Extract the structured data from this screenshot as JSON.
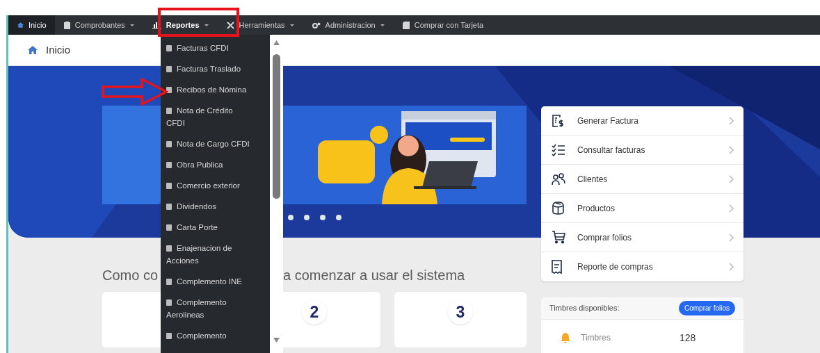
{
  "nav": {
    "items": [
      {
        "label": "Inicio",
        "selected": true,
        "dropdown": false,
        "expanded": false
      },
      {
        "label": "Comprobantes",
        "selected": false,
        "dropdown": true,
        "expanded": false
      },
      {
        "label": "Reportes",
        "selected": false,
        "dropdown": true,
        "expanded": true
      },
      {
        "label": "Herramientas",
        "selected": false,
        "dropdown": true,
        "expanded": false
      },
      {
        "label": "Administracion",
        "selected": false,
        "dropdown": true,
        "expanded": false
      },
      {
        "label": "Comprar con Tarjeta",
        "selected": false,
        "dropdown": false,
        "expanded": false
      }
    ]
  },
  "breadcrumb": {
    "label": "Inicio"
  },
  "reportes_menu": {
    "items": [
      {
        "label": "Facturas CFDI"
      },
      {
        "label": "Facturas Traslado"
      },
      {
        "label": "Recibos de Nómina"
      },
      {
        "label": "Nota de Crédito CFDI"
      },
      {
        "label": "Nota de Cargo CFDI"
      },
      {
        "label": "Obra Publica"
      },
      {
        "label": "Comercio exterior"
      },
      {
        "label": "Dividendos"
      },
      {
        "label": "Carta Porte"
      },
      {
        "label": "Enajenacion de Acciones"
      },
      {
        "label": "Complemento INE"
      },
      {
        "label": "Complemento Aerolineas"
      },
      {
        "label": "Complemento"
      }
    ]
  },
  "heading": {
    "left_part": "Como co",
    "right_part": "a comenzar a usar el sistema"
  },
  "step_cards": [
    {
      "kind": "blank"
    },
    {
      "kind": "numbered",
      "number": "2"
    },
    {
      "kind": "numbered",
      "number": "3"
    }
  ],
  "quick_links": [
    {
      "label": "Generar Factura"
    },
    {
      "label": "Consultar facturas"
    },
    {
      "label": "Clientes"
    },
    {
      "label": "Productos"
    },
    {
      "label": "Comprar folios"
    },
    {
      "label": "Reporte de compras"
    }
  ],
  "timbres": {
    "title": "Timbres disponibles:",
    "button": "Comprar folios",
    "rows": [
      {
        "label": "Timbres",
        "value": "128"
      }
    ]
  }
}
